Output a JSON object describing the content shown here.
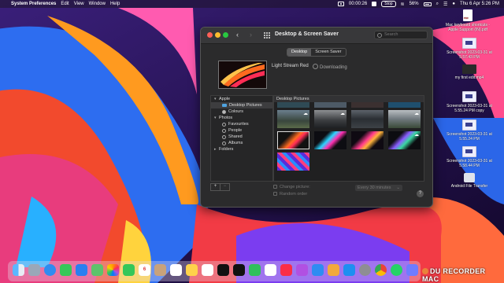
{
  "menubar": {
    "app_name": "System Preferences",
    "items": [
      "Edit",
      "View",
      "Window",
      "Help"
    ],
    "timer": "00:00:26",
    "button": "Stop",
    "battery": "56%",
    "datetime": "Thu 6 Apr  5:26 PM"
  },
  "desktop_icons": [
    {
      "label": "Mac keyboard shortcuts - Apple Support (IN).pdf",
      "kind": "pdf"
    },
    {
      "label": "Screenshot 2023-03-31 at 5.57.43 PM",
      "kind": "screenshot"
    },
    {
      "label": "my first edit.mp4",
      "kind": "video"
    },
    {
      "label": "Screenshot 2023-03-31 at 5.55.24 PM copy",
      "kind": "screenshot"
    },
    {
      "label": "Screenshot 2023-03-31 at 5.55.24 PM",
      "kind": "screenshot"
    },
    {
      "label": "Screenshot 2023-03-31 at 5.58.44 PM",
      "kind": "screenshot"
    },
    {
      "label": "Android File Transfer",
      "kind": "app"
    }
  ],
  "window": {
    "title": "Desktop & Screen Saver",
    "search_placeholder": "Search",
    "tabs": [
      {
        "label": "Desktop",
        "active": true
      },
      {
        "label": "Screen Saver",
        "active": false
      }
    ],
    "current_picture": "Light Stream Red",
    "status": "Downloading",
    "sidebar": [
      {
        "label": "Apple",
        "level": 0,
        "icon": "triangle-down"
      },
      {
        "label": "Desktop Pictures",
        "level": 1,
        "icon": "folder",
        "selected": true
      },
      {
        "label": "Colours",
        "level": 1,
        "icon": "color-wheel"
      },
      {
        "label": "Photos",
        "level": 0,
        "icon": "triangle-down"
      },
      {
        "label": "Favourites",
        "level": 1,
        "icon": "circle"
      },
      {
        "label": "People",
        "level": 1,
        "icon": "circle"
      },
      {
        "label": "Shared",
        "level": 1,
        "icon": "circle"
      },
      {
        "label": "Albums",
        "level": 1,
        "icon": "circle"
      },
      {
        "label": "Folders",
        "level": 0,
        "icon": "triangle-right"
      }
    ],
    "gallery_title": "Desktop Pictures",
    "add_label": "+",
    "remove_label": "−",
    "change_picture_label": "Change picture:",
    "change_picture_interval": "Every 30 minutes",
    "random_order_label": "Random order",
    "help_label": "?"
  },
  "dock_apps": [
    "Finder",
    "Launchpad",
    "Safari",
    "Messages",
    "Mail",
    "Maps",
    "Photos",
    "FaceTime",
    "Calendar",
    "Contacts",
    "Reminders",
    "Notes",
    "TV",
    "Music",
    "Podcasts",
    "News",
    "Numbers",
    "Keynote",
    "Pages",
    "App Store",
    "System Preferences",
    "Chrome",
    "WhatsApp",
    "Preview",
    "Downloads",
    "Trash"
  ],
  "watermark": "DU RECORDER MAC",
  "colors": {
    "accent": "#4fa3e0",
    "window_bg": "#2b2b2c"
  }
}
